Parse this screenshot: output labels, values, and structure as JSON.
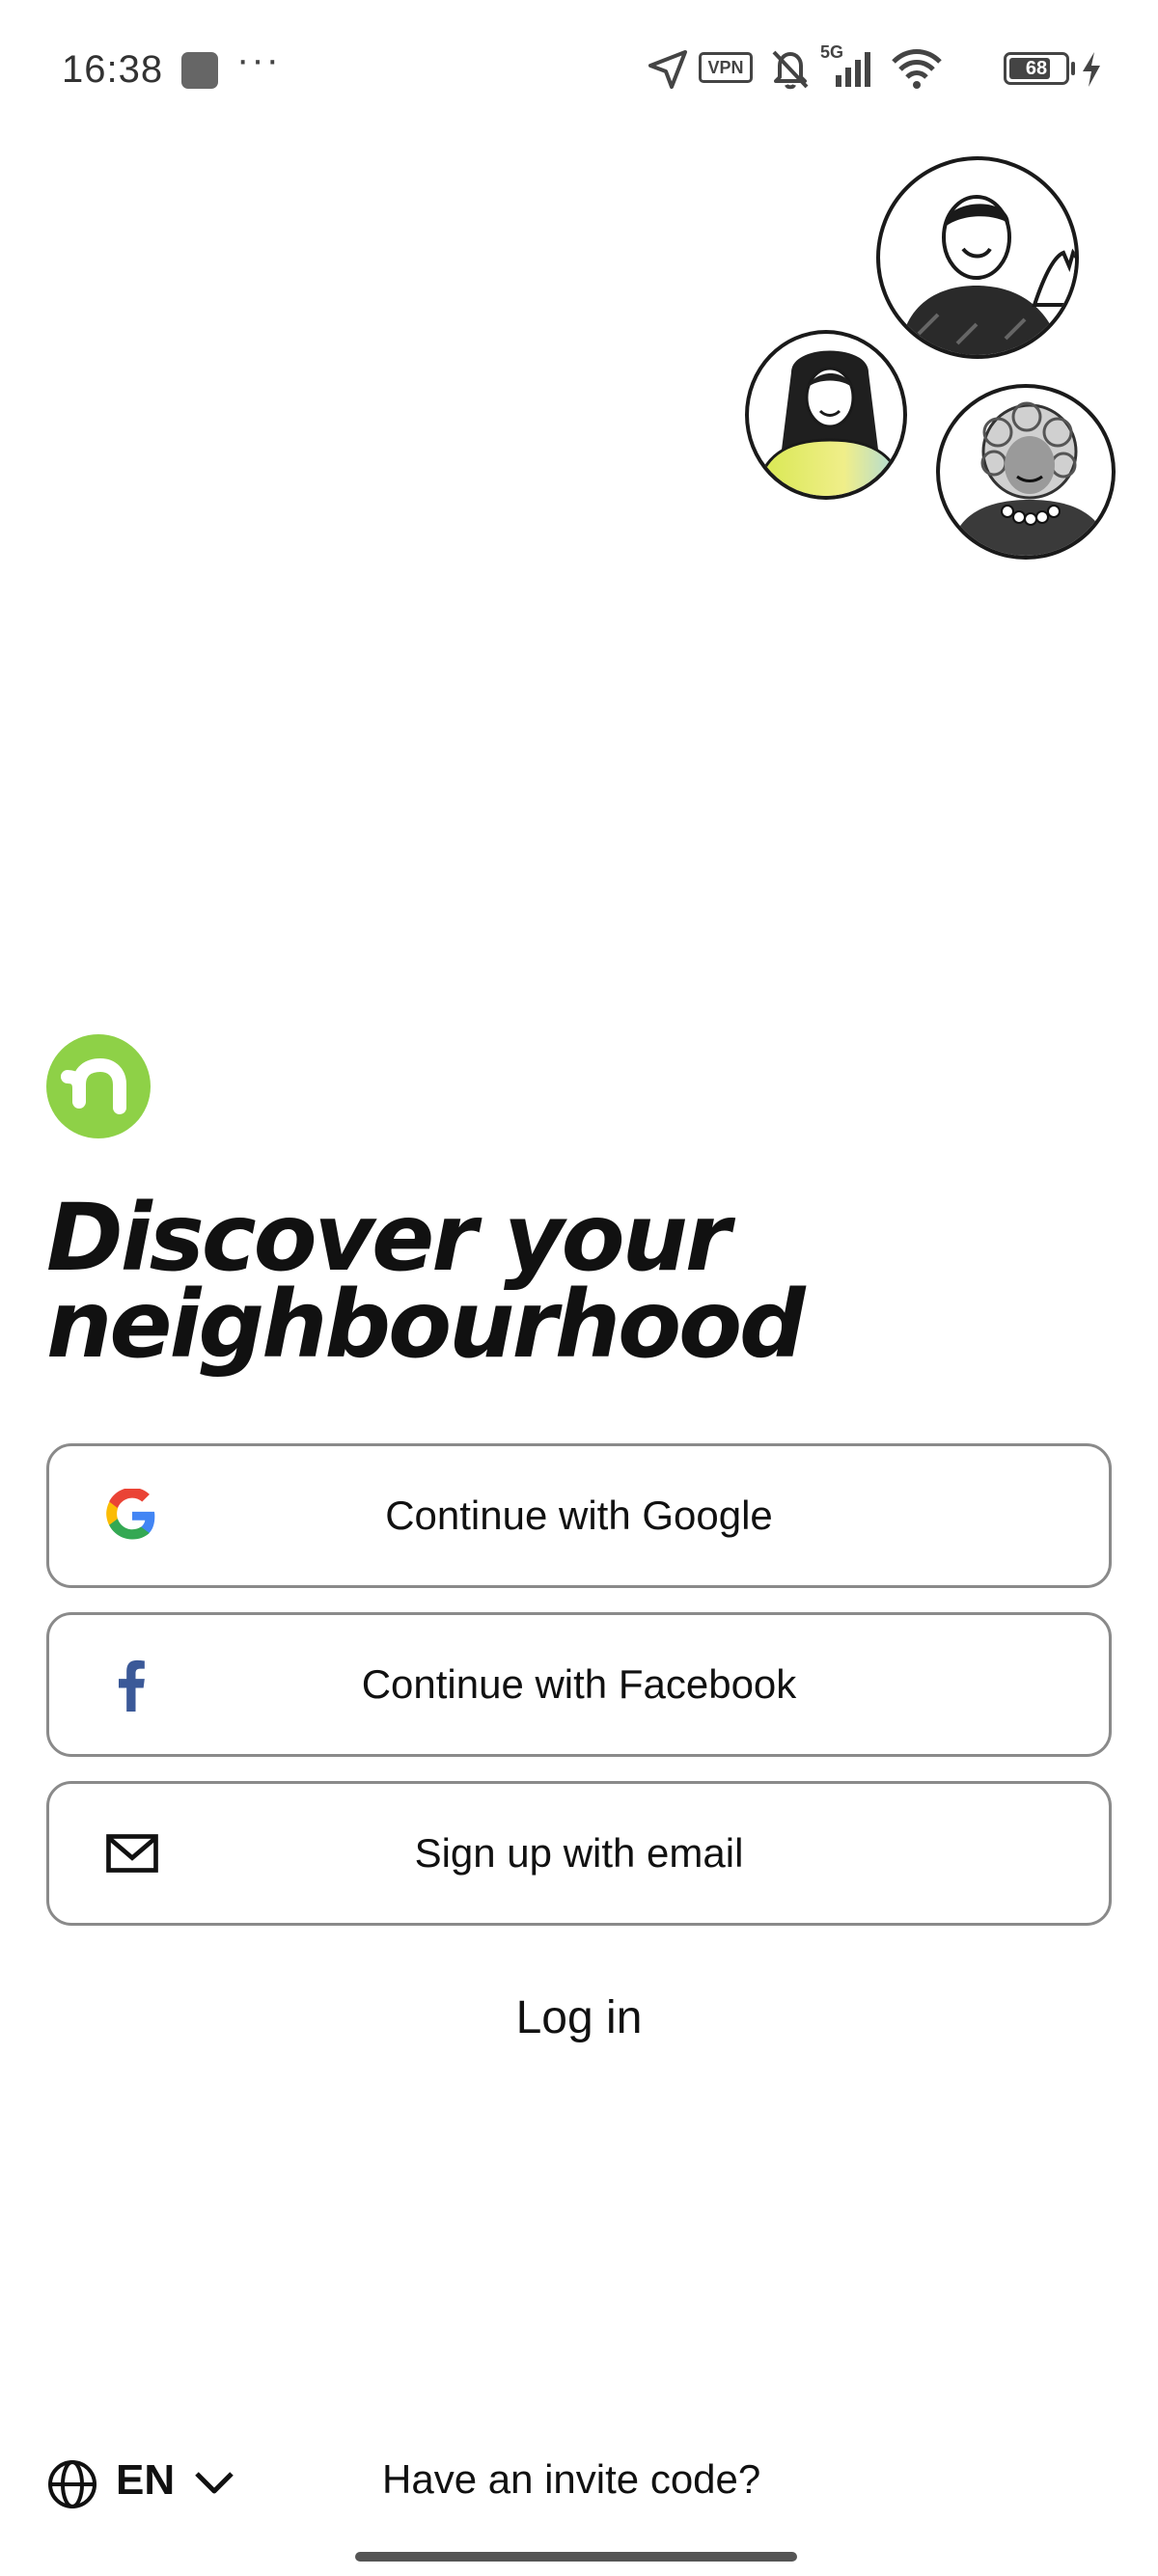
{
  "status_bar": {
    "time": "16:38",
    "dots": "···",
    "vpn": "VPN",
    "network": "5G",
    "battery_level": "68",
    "icons": [
      "location-arrow-icon",
      "vpn-icon",
      "mute-bell-icon",
      "signal-icon",
      "wifi-icon",
      "battery-icon",
      "charging-icon"
    ]
  },
  "brand": {
    "logo_icon": "nextdoor-logo-icon",
    "accent": "#8ed147"
  },
  "hero": {
    "headline_line1": "Discover your",
    "headline_line2": "neighbourhood"
  },
  "auth": {
    "google_label": "Continue with Google",
    "facebook_label": "Continue with Facebook",
    "email_label": "Sign up with email",
    "login_label": "Log in"
  },
  "footer": {
    "language": "EN",
    "invite_label": "Have an invite code?"
  }
}
